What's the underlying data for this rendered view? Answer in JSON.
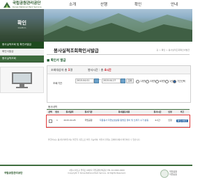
{
  "header": {
    "logo_ko": "국립공원관리공단",
    "logo_en": "Korea National Park Service",
    "nav": [
      "소개",
      "산행",
      "확인",
      "안내"
    ]
  },
  "sidebar": {
    "title": "확인",
    "subtitle": "Confirm",
    "items": [
      {
        "label": "봉사실적조회 및 확인서발급",
        "state": "active"
      },
      {
        "label": "확인서발급",
        "state": "sub"
      },
      {
        "label": "봉사실적조회",
        "state": "normal"
      }
    ]
  },
  "content": {
    "page_title": "봉사실적조회확인서발급",
    "breadcrumb": "홈 > 확인 > 봉사실적조회확인서발급",
    "section_title": "확인서 발급",
    "tabs": {
      "count_label": "조회대상자 총",
      "count_value": "1",
      "total_label": "봉사시간 : 총",
      "total_value": "4시간"
    },
    "search": {
      "period_label": "조회기간",
      "date_from": "2015.04.01",
      "date_to": "2015.04.27",
      "button_label": "조회",
      "radios": [
        "1개월",
        "3개월",
        "6개월",
        "1년",
        "기간선택"
      ]
    },
    "list_label": "봉사내역",
    "table": {
      "headers": [
        "선택",
        "번호",
        "봉사일자",
        "봉사기관",
        "봉사활동내용",
        "봉사시간",
        "인정",
        "비고"
      ],
      "row": {
        "num": "1",
        "date": "2015.04.25",
        "org": "국립공원",
        "content": "자원봉사 자연보호활동 탐방로 정비 및 쓰레기 수거 활동",
        "hours": "4시간",
        "approved": "인정",
        "note": "확인서발급"
      }
    },
    "notice": "발급하시는 봉사실적확인서는 발급일 기준으로 확인 가능하며, 확인서 진위는 홈페이지에서 확인하실 수 있습니다.",
    "issue_button": "확인서 발급 ▶"
  },
  "footer": {
    "logo": "국립공원관리공단",
    "address": "서울시 마포구 연희로 00번지 국립공원관리공단 TEL 02-0000-0000",
    "copyright": "Copyright © Korea National Park Service. All Rights Reserved.",
    "badge_text": "국립공원\n자연보호"
  },
  "colors": {
    "brand_green": "#3e6d3e",
    "accent_blue": "#2a5f9e",
    "highlight_red": "#e23b3b"
  }
}
